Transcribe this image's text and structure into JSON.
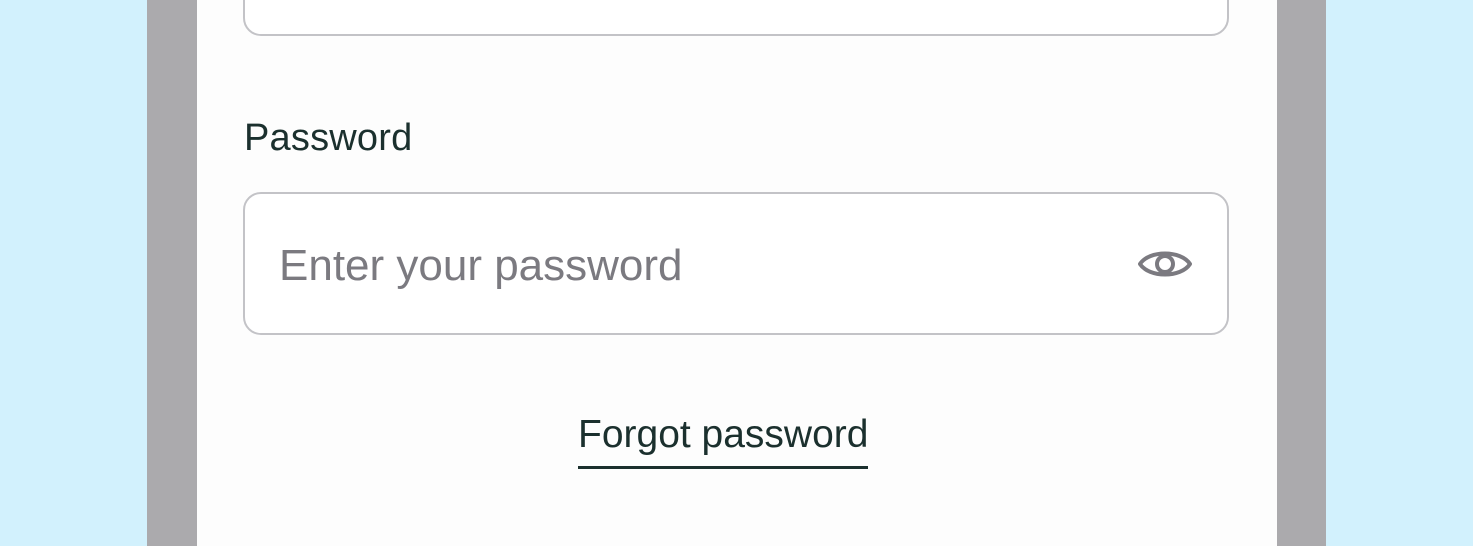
{
  "form": {
    "password_label": "Password",
    "password_placeholder": "Enter your password",
    "password_value": "",
    "toggle_icon": "eye-icon",
    "forgot_password_link": "Forgot password"
  },
  "colors": {
    "page_background": "#d2f1fd",
    "frame": "#abaaad",
    "card": "#fdfdfd",
    "text_primary": "#1b302e",
    "placeholder": "#7b7a80",
    "field_border": "#c3c3c7"
  }
}
